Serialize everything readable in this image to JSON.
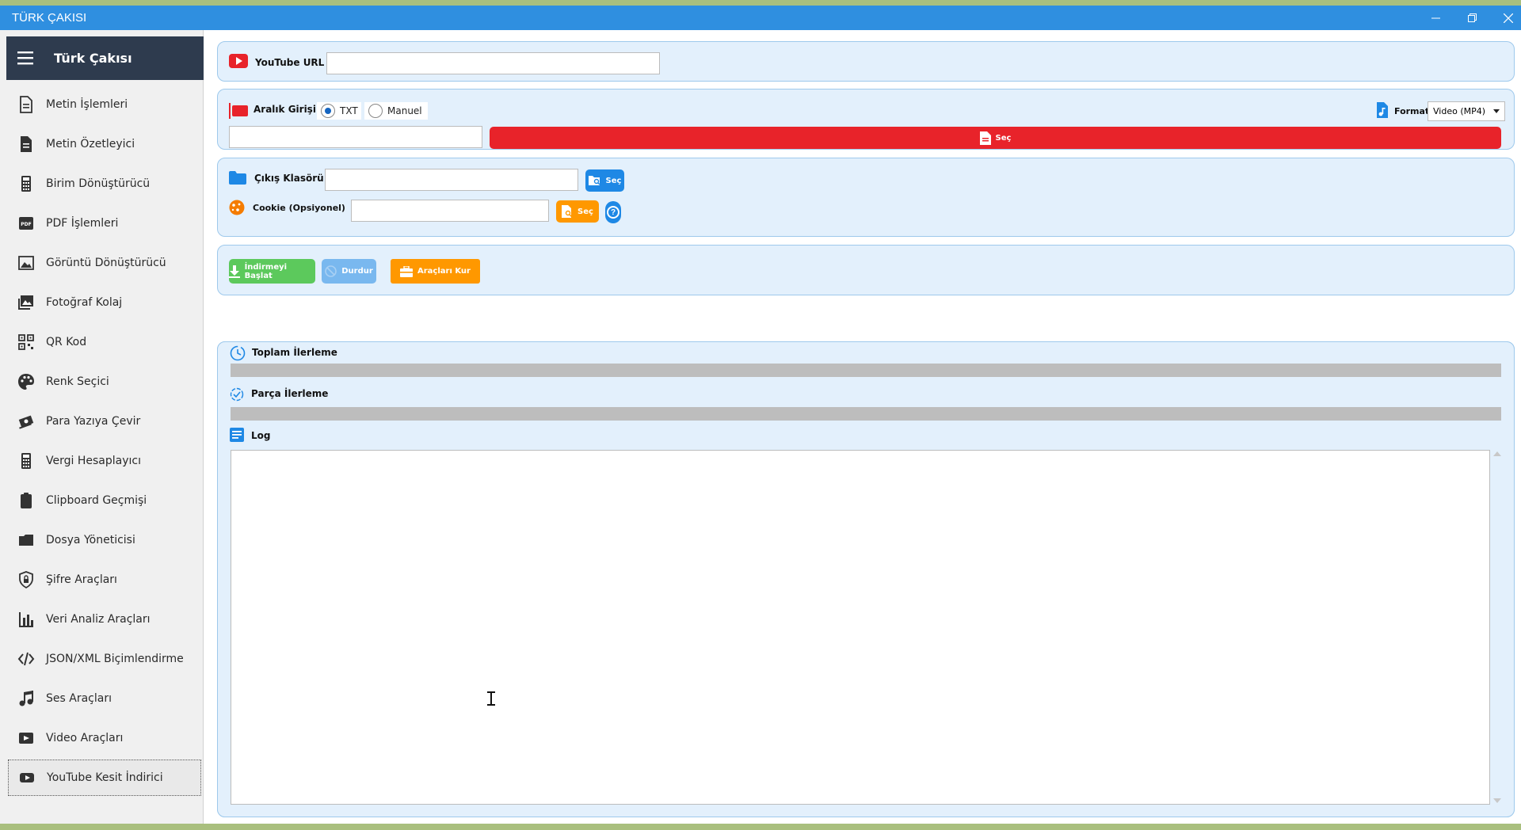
{
  "window": {
    "title": "TÜRK ÇAKISI"
  },
  "sidebar": {
    "app_title": "Türk Çakısı",
    "items": [
      {
        "label": "Metin İşlemleri",
        "icon": "document-icon"
      },
      {
        "label": "Metin Özetleyici",
        "icon": "document-lines-icon"
      },
      {
        "label": "Birim Dönüştürücü",
        "icon": "calculator-icon"
      },
      {
        "label": "PDF İşlemleri",
        "icon": "pdf-icon"
      },
      {
        "label": "Görüntü Dönüştürücü",
        "icon": "image-icon"
      },
      {
        "label": "Fotoğraf Kolaj",
        "icon": "photo-icon"
      },
      {
        "label": "QR Kod",
        "icon": "qr-code-icon"
      },
      {
        "label": "Renk Seçici",
        "icon": "palette-icon"
      },
      {
        "label": "Para Yazıya Çevir",
        "icon": "money-icon"
      },
      {
        "label": "Vergi Hesaplayıcı",
        "icon": "calculator-icon"
      },
      {
        "label": "Clipboard Geçmişi",
        "icon": "clipboard-icon"
      },
      {
        "label": "Dosya Yöneticisi",
        "icon": "folder-icon"
      },
      {
        "label": "Şifre Araçları",
        "icon": "shield-lock-icon"
      },
      {
        "label": "Veri Analiz Araçları",
        "icon": "bar-chart-icon"
      },
      {
        "label": "JSON/XML Biçimlendirme",
        "icon": "code-icon"
      },
      {
        "label": "Ses Araçları",
        "icon": "music-note-icon"
      },
      {
        "label": "Video Araçları",
        "icon": "video-icon"
      },
      {
        "label": "YouTube Kesit İndirici",
        "icon": "youtube-icon",
        "active": true
      }
    ]
  },
  "url_panel": {
    "label": "YouTube URL",
    "value": ""
  },
  "range_panel": {
    "label": "Aralık Girişi",
    "options": [
      "TXT",
      "Manuel"
    ],
    "selected": "TXT",
    "input_value": "",
    "select_button": "Seç",
    "format_label": "Format:",
    "format_value": "Video (MP4)"
  },
  "output_panel": {
    "folder_label": "Çıkış Klasörü",
    "folder_value": "",
    "folder_button": "Seç",
    "cookie_label": "Cookie (Opsiyonel)",
    "cookie_value": "",
    "cookie_button": "Seç",
    "help": "?"
  },
  "actions": {
    "start": "İndirmeyi Başlat",
    "stop": "Durdur",
    "install": "Araçları Kur"
  },
  "progress": {
    "total_label": "Toplam İlerleme",
    "total_fraction": 0,
    "part_label": "Parça İlerleme",
    "part_fraction": 0,
    "log_label": "Log",
    "log_text": ""
  },
  "colors": {
    "titlebar": "#2f8fe0",
    "sidebar_header": "#2e3b4e",
    "red": "#e8232a",
    "blue": "#1e88e5",
    "orange": "#ff9800",
    "green": "#5cc95c",
    "light_blue": "#79b8ef"
  }
}
